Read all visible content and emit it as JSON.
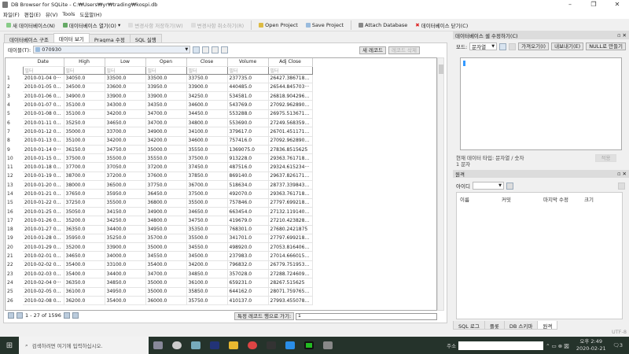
{
  "window": {
    "title": "DB Browser for SQLite - C:₩Users₩yr₩trading₩kospi.db",
    "minimize": "–",
    "maximize": "❐",
    "close": "✕"
  },
  "menu": [
    "파일(F)",
    "편집(E)",
    "뷰(V)",
    "Tools",
    "도움말(H)"
  ],
  "toolbar": {
    "new_db": "새 데이터베이스(N)",
    "open_db": "데이터베이스 열기(O)",
    "write_changes": "변경사항 저장하기(W)",
    "revert_changes": "변경사항 취소하기(R)",
    "open_project": "Open Project",
    "save_project": "Save Project",
    "attach_db": "Attach Database",
    "close_db": "데이터베이스 닫기(C)"
  },
  "tabs": [
    "데이터베이스 구조",
    "데이터 보기",
    "Pragma 수정",
    "SQL 실행"
  ],
  "browse": {
    "table_label": "테이블(T):",
    "table_value": "070930",
    "new_record": "새 레코드",
    "delete_record": "레코드 삭제",
    "filter_placeholder": "필터",
    "columns": [
      "Date",
      "High",
      "Low",
      "Open",
      "Close",
      "Volume",
      "Adj Close"
    ],
    "rows": [
      [
        "2010-01-04 0···",
        "34050.0",
        "33500.0",
        "33500.0",
        "33750.0",
        "237735.0",
        "26427.38671875"
      ],
      [
        "2010-01-05 00···",
        "34500.0",
        "33600.0",
        "33950.0",
        "33900.0",
        "440485.0",
        "26544.845703···"
      ],
      [
        "2010-01-06 00···",
        "34900.0",
        "33900.0",
        "33900.0",
        "34250.0",
        "534581.0",
        "26818.904296875"
      ],
      [
        "2010-01-07 00···",
        "35100.0",
        "34300.0",
        "34350.0",
        "34600.0",
        "543769.0",
        "27092.962890625"
      ],
      [
        "2010-01-08 00···",
        "35100.0",
        "34200.0",
        "34700.0",
        "34450.0",
        "553288.0",
        "26975.513671875"
      ],
      [
        "2010-01-11 00···",
        "35250.0",
        "34650.0",
        "34700.0",
        "34800.0",
        "553690.0",
        "27249.568359375"
      ],
      [
        "2010-01-12 00···",
        "35000.0",
        "33700.0",
        "34900.0",
        "34100.0",
        "379617.0",
        "26701.451171875"
      ],
      [
        "2010-01-13 00···",
        "35100.0",
        "34200.0",
        "34200.0",
        "34600.0",
        "757416.0",
        "27092.962890625"
      ],
      [
        "2010-01-14 0···",
        "36150.0",
        "34750.0",
        "35000.0",
        "35550.0",
        "1369075.0",
        "27836.8515625"
      ],
      [
        "2010-01-15 00···",
        "37500.0",
        "35500.0",
        "35550.0",
        "37500.0",
        "913228.0",
        "29363.76171875"
      ],
      [
        "2010-01-18 00···",
        "37700.0",
        "37050.0",
        "37200.0",
        "37450.0",
        "487516.0",
        "29324.615234···"
      ],
      [
        "2010-01-19 00···",
        "38700.0",
        "37200.0",
        "37600.0",
        "37850.0",
        "869140.0",
        "29637.826171875"
      ],
      [
        "2010-01-20 00···",
        "38000.0",
        "36500.0",
        "37750.0",
        "36700.0",
        "518634.0",
        "28737.33984375"
      ],
      [
        "2010-01-21 00···",
        "37650.0",
        "35950.0",
        "36450.0",
        "37500.0",
        "492070.0",
        "29363.76171875"
      ],
      [
        "2010-01-22 00···",
        "37250.0",
        "35500.0",
        "36800.0",
        "35500.0",
        "757846.0",
        "27797.69921875"
      ],
      [
        "2010-01-25 00···",
        "35050.0",
        "34150.0",
        "34900.0",
        "34650.0",
        "663454.0",
        "27132.119140625"
      ],
      [
        "2010-01-26 00···",
        "35200.0",
        "34250.0",
        "34800.0",
        "34750.0",
        "419679.0",
        "27210.423828125"
      ],
      [
        "2010-01-27 00···",
        "36350.0",
        "34400.0",
        "34950.0",
        "35350.0",
        "768301.0",
        "27680.2421875"
      ],
      [
        "2010-01-28 00···",
        "35950.0",
        "35250.0",
        "35700.0",
        "35500.0",
        "341701.0",
        "27797.69921875"
      ],
      [
        "2010-01-29 00···",
        "35200.0",
        "33900.0",
        "35000.0",
        "34550.0",
        "498920.0",
        "27053.81640625"
      ],
      [
        "2010-02-01 00···",
        "34650.0",
        "34000.0",
        "34550.0",
        "34500.0",
        "237983.0",
        "27014.666015625"
      ],
      [
        "2010-02-02 00···",
        "35400.0",
        "33100.0",
        "35400.0",
        "34200.0",
        "796832.0",
        "26779.751953125"
      ],
      [
        "2010-02-03 00···",
        "35400.0",
        "34400.0",
        "34700.0",
        "34850.0",
        "357028.0",
        "27288.724609375"
      ],
      [
        "2010-02-04 0···",
        "36350.0",
        "34850.0",
        "35000.0",
        "36100.0",
        "659231.0",
        "28267.515625"
      ],
      [
        "2010-02-05 00···",
        "36100.0",
        "34950.0",
        "35000.0",
        "35850.0",
        "644162.0",
        "28071.759765625"
      ],
      [
        "2010-02-08 00···",
        "36200.0",
        "35400.0",
        "36000.0",
        "35750.0",
        "410137.0",
        "27993.455078125"
      ]
    ],
    "pager_text": "1 - 27 of 1596",
    "goto_label": "특정 레코드 행으로 가기:",
    "goto_value": "1"
  },
  "cell_editor": {
    "title": "데이터베이스 셀 수정하기(C)",
    "mode_label": "모드:",
    "mode_value": "문자열",
    "import": "가져오기(I)",
    "export": "내보내기(E)",
    "set_null": "NULL로 만들기",
    "type_text": "현재 데이터 타입: 문자열 / 숫자",
    "size_text": "1 문자",
    "apply": "적용"
  },
  "remote": {
    "title": "원격",
    "identity_label": "아이디",
    "columns": [
      "이름",
      "커밋",
      "마지막 수정",
      "크기"
    ]
  },
  "bottom_tabs": [
    "SQL 로그",
    "플롯",
    "DB 스키마",
    "원격"
  ],
  "status": {
    "encoding": "UTF-8"
  },
  "taskbar": {
    "search_placeholder": "검색하려면 여기에 입력하십시오.",
    "address_label": "주소",
    "time": "오후 2:49",
    "date": "2020-02-21",
    "notifications": "3"
  }
}
